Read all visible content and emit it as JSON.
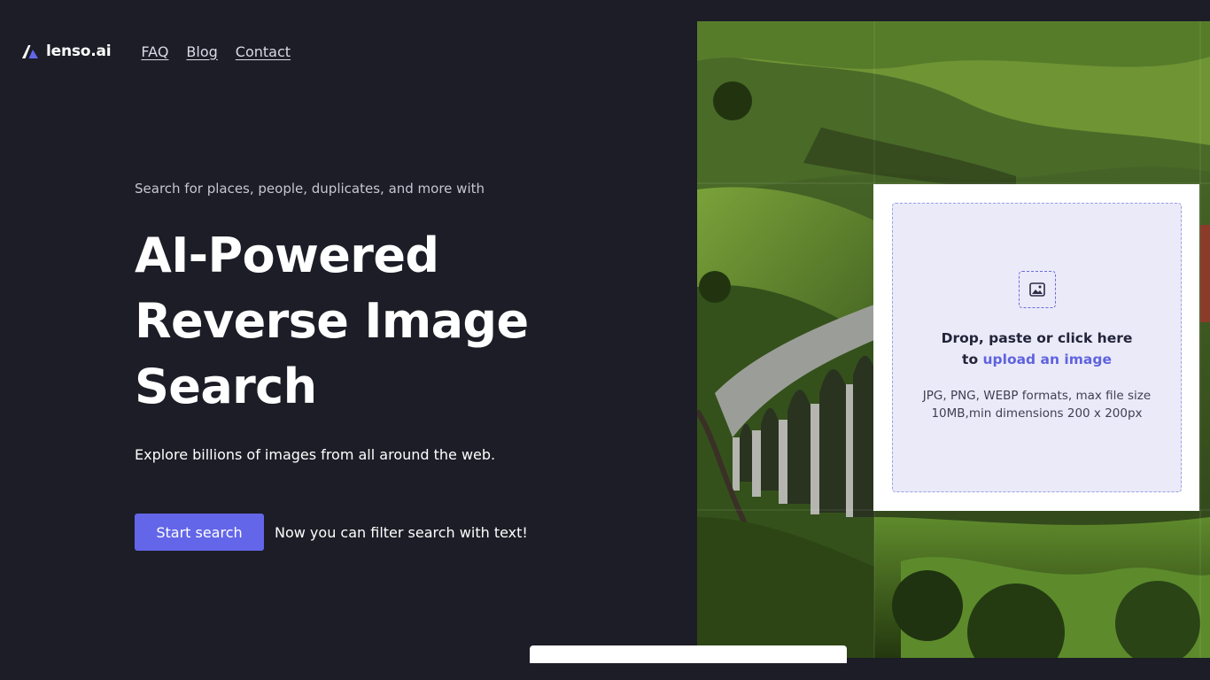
{
  "brand": {
    "name": "lenso.ai"
  },
  "nav": [
    {
      "label": "FAQ"
    },
    {
      "label": "Blog"
    },
    {
      "label": "Contact"
    }
  ],
  "hero": {
    "kicker": "Search for places, people, duplicates, and more with",
    "headline_lines": [
      "AI-Powered",
      "Reverse Image",
      "Search"
    ],
    "subtext": "Explore billions of images from all around the web.",
    "start_label": "Start search",
    "filter_note": "Now you can filter search with text!"
  },
  "upload": {
    "title_line1": "Drop, paste or click here",
    "title_to": "to",
    "link_text": "upload an image",
    "formats_line1": "JPG, PNG, WEBP formats, max file size",
    "formats_line2": "10MB,min dimensions 200 x 200px",
    "icon": "image-icon"
  },
  "colors": {
    "background": "#1c1d26",
    "accent": "#6366e8",
    "link": "#5f63de",
    "dropzone_bg": "#ebeaf9"
  }
}
